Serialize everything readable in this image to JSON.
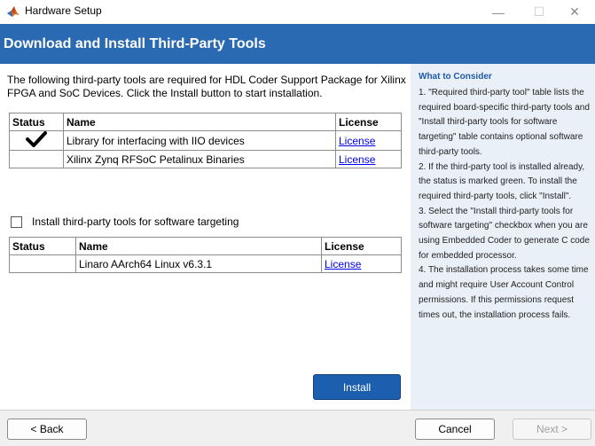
{
  "window": {
    "title": "Hardware Setup",
    "minimize_glyph": "—",
    "maximize_glyph": "☐",
    "close_glyph": "✕"
  },
  "banner": {
    "title": "Download and Install Third-Party Tools"
  },
  "intro": "The following third-party tools are required for HDL Coder Support Package for Xilinx FPGA and SoC Devices. Click the Install button to start installation.",
  "required_table": {
    "headers": {
      "status": "Status",
      "name": "Name",
      "license": "License"
    },
    "rows": [
      {
        "status_icon": "checkmark-icon",
        "status": "✔",
        "name": "Library for interfacing with IIO devices",
        "license": "License"
      },
      {
        "status": "",
        "name": "Xilinx Zynq RFSoC Petalinux Binaries",
        "license": "License"
      }
    ]
  },
  "software_checkbox": {
    "label": "Install third-party tools for software targeting",
    "checked": false
  },
  "software_table": {
    "headers": {
      "status": "Status",
      "name": "Name",
      "license": "License"
    },
    "rows": [
      {
        "status": "",
        "name": "Linaro AArch64 Linux v6.3.1",
        "license": "License"
      }
    ]
  },
  "install_button": "Install",
  "side_panel": {
    "heading": "What to Consider",
    "paragraphs": [
      "1. \"Required third-party tool\" table lists the required board-specific third-party tools and \"Install third-party tools for software targeting\" table contains optional software third-party tools.",
      "2. If the third-party tool is installed already, the status is marked green. To install the required third-party tools, click \"Install\".",
      "3. Select the \"Install third-party tools for software targeting\" checkbox when you are using Embedded Coder to generate C code for embedded processor.",
      "4. The installation process takes some time and might require User Account Control permissions. If this permissions request times out, the installation process fails."
    ]
  },
  "footer": {
    "back": "< Back",
    "cancel": "Cancel",
    "next": "Next >"
  },
  "colors": {
    "banner": "#2a6ab2",
    "install_button": "#1b5fae",
    "side_panel": "#e9f0f8"
  }
}
